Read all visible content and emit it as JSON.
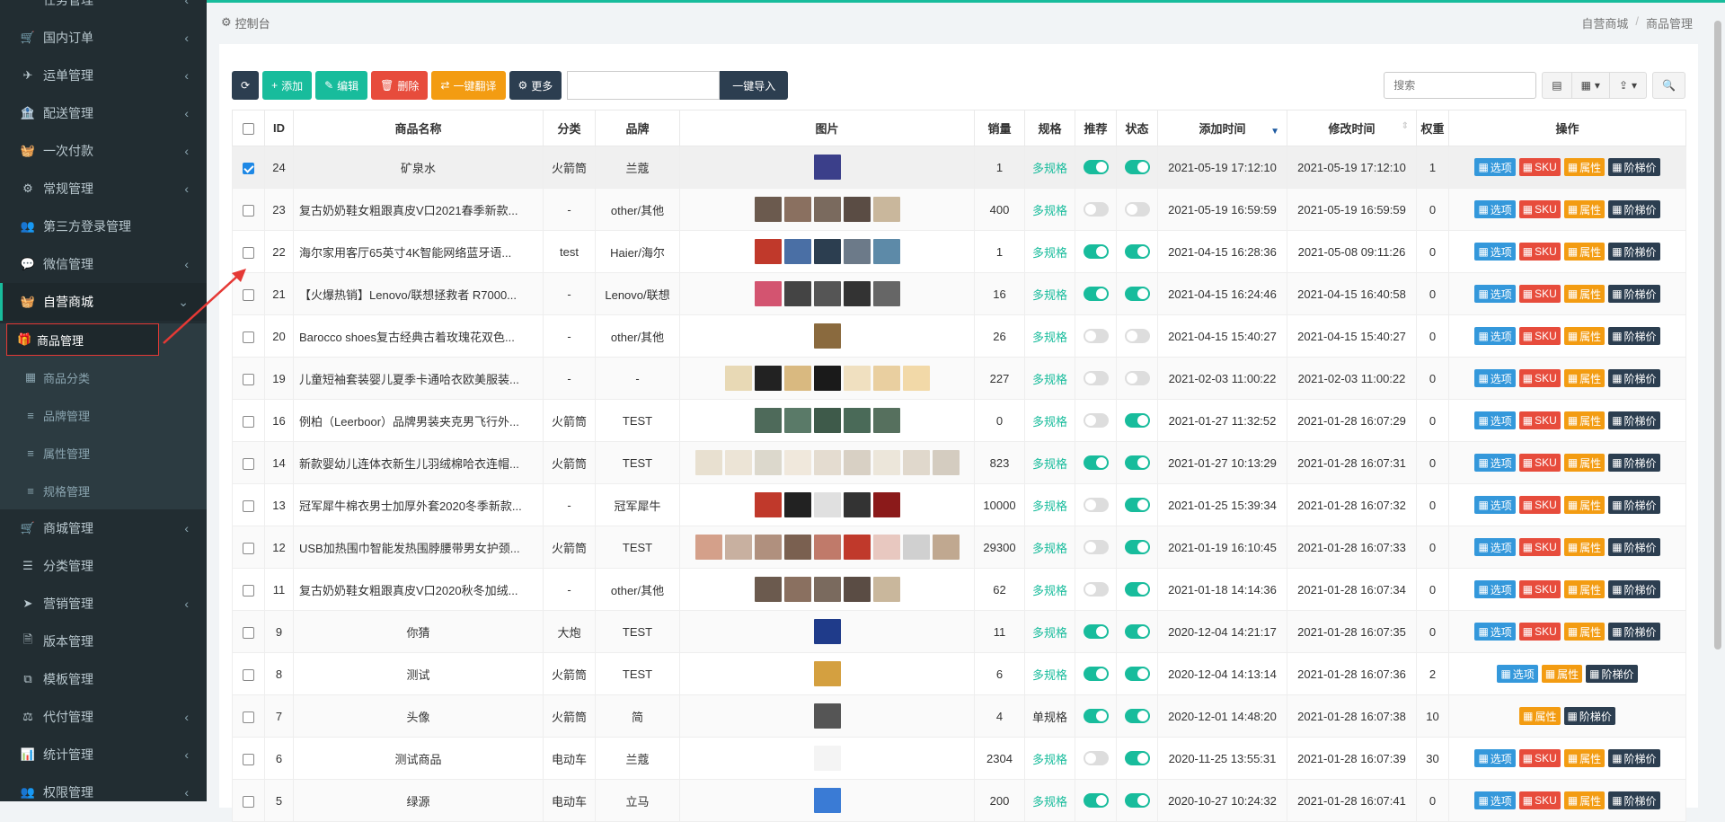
{
  "sidebar": {
    "items": [
      {
        "label": "任务管理",
        "icon": "",
        "chev": "‹"
      },
      {
        "label": "国内订单",
        "icon": "🛒",
        "chev": "‹"
      },
      {
        "label": "运单管理",
        "icon": "✈",
        "chev": "‹"
      },
      {
        "label": "配送管理",
        "icon": "🏦",
        "chev": "‹"
      },
      {
        "label": "一次付款",
        "icon": "🧺",
        "chev": "‹"
      },
      {
        "label": "常规管理",
        "icon": "⚙",
        "chev": "‹"
      },
      {
        "label": "第三方登录管理",
        "icon": "👥",
        "chev": ""
      },
      {
        "label": "微信管理",
        "icon": "💬",
        "chev": "‹"
      },
      {
        "label": "自营商城",
        "icon": "🧺",
        "chev": "⌄"
      }
    ],
    "subitems": [
      {
        "label": "商品管理",
        "icon": "🎁"
      },
      {
        "label": "商品分类",
        "icon": "▦"
      },
      {
        "label": "品牌管理",
        "icon": "≡"
      },
      {
        "label": "属性管理",
        "icon": "≡"
      },
      {
        "label": "规格管理",
        "icon": "≡"
      }
    ],
    "items2": [
      {
        "label": "商城管理",
        "icon": "🛒",
        "chev": "‹"
      },
      {
        "label": "分类管理",
        "icon": "☰",
        "chev": ""
      },
      {
        "label": "营销管理",
        "icon": "➤",
        "chev": "‹"
      },
      {
        "label": "版本管理",
        "icon": "🗎",
        "chev": ""
      },
      {
        "label": "模板管理",
        "icon": "⧉",
        "chev": ""
      },
      {
        "label": "代付管理",
        "icon": "⚖",
        "chev": "‹"
      },
      {
        "label": "统计管理",
        "icon": "📊",
        "chev": "‹"
      },
      {
        "label": "权限管理",
        "icon": "👥",
        "chev": "‹"
      }
    ]
  },
  "breadcrumb": {
    "left_icon": "⚙",
    "left": "控制台",
    "right": [
      "自营商城",
      "商品管理"
    ],
    "sep": "/"
  },
  "toolbar": {
    "refresh_icon": "⟳",
    "add": "添加",
    "add_icon": "+",
    "edit": "编辑",
    "edit_icon": "✎",
    "delete": "删除",
    "delete_icon": "🗑",
    "translate": "一键翻译",
    "translate_icon": "⇄",
    "more": "更多",
    "more_icon": "⚙",
    "import_input": "",
    "import": "一键导入",
    "search_placeholder": "搜索",
    "view_icon": "▤",
    "columns_icon": "▦",
    "export_icon": "⇪",
    "search_icon": "🔍"
  },
  "table": {
    "headers": [
      "ID",
      "商品名称",
      "分类",
      "品牌",
      "图片",
      "销量",
      "规格",
      "推荐",
      "状态",
      "添加时间",
      "修改时间",
      "权重",
      "操作"
    ],
    "sort_arrow": "▼",
    "op_labels": {
      "options": "选项",
      "sku": "SKU",
      "attr": "属性",
      "tier": "阶梯价"
    },
    "op_icons": {
      "options": "▦",
      "sku": "▦",
      "attr": "▦",
      "tier": "▦"
    },
    "rows": [
      {
        "id": "24",
        "name": "矿泉水",
        "center": true,
        "cat": "火箭筒",
        "brand": "兰蔻",
        "imgs": [
          "#3b3f8a"
        ],
        "sales": "1",
        "spec": "多规格",
        "rec": true,
        "status": true,
        "added": "2021-05-19 17:12:10",
        "modified": "2021-05-19 17:12:10",
        "weight": "1",
        "ops": [
          "options",
          "sku",
          "attr",
          "tier"
        ],
        "checked": true
      },
      {
        "id": "23",
        "name": "复古奶奶鞋女粗跟真皮V口2021春季新款...",
        "center": false,
        "cat": "-",
        "brand": "other/其他",
        "imgs": [
          "#6b5a4e",
          "#8a7060",
          "#7a6a5e",
          "#5a4c44",
          "#c9b79c"
        ],
        "sales": "400",
        "spec": "多规格",
        "rec": false,
        "status": false,
        "added": "2021-05-19 16:59:59",
        "modified": "2021-05-19 16:59:59",
        "weight": "0",
        "ops": [
          "options",
          "sku",
          "attr",
          "tier"
        ],
        "checked": false
      },
      {
        "id": "22",
        "name": "海尔家用客厅65英寸4K智能网络蓝牙语...",
        "center": false,
        "cat": "test",
        "brand": "Haier/海尔",
        "imgs": [
          "#c0392b",
          "#4a6fa5",
          "#2c3e50",
          "#6c7a89",
          "#5d8aa8"
        ],
        "sales": "1",
        "spec": "多规格",
        "rec": true,
        "status": true,
        "added": "2021-04-15 16:28:36",
        "modified": "2021-05-08 09:11:26",
        "weight": "0",
        "ops": [
          "options",
          "sku",
          "attr",
          "tier"
        ],
        "checked": false
      },
      {
        "id": "21",
        "name": "【火爆热销】Lenovo/联想拯救者 R7000...",
        "center": false,
        "cat": "-",
        "brand": "Lenovo/联想",
        "imgs": [
          "#d35470",
          "#444",
          "#555",
          "#333",
          "#666"
        ],
        "sales": "16",
        "spec": "多规格",
        "rec": true,
        "status": true,
        "added": "2021-04-15 16:24:46",
        "modified": "2021-04-15 16:40:58",
        "weight": "0",
        "ops": [
          "options",
          "sku",
          "attr",
          "tier"
        ],
        "checked": false
      },
      {
        "id": "20",
        "name": "Barocco shoes复古经典古着玫瑰花双色...",
        "center": false,
        "cat": "-",
        "brand": "other/其他",
        "imgs": [
          "#8a6a3e"
        ],
        "sales": "26",
        "spec": "多规格",
        "rec": false,
        "status": false,
        "added": "2021-04-15 15:40:27",
        "modified": "2021-04-15 15:40:27",
        "weight": "0",
        "ops": [
          "options",
          "sku",
          "attr",
          "tier"
        ],
        "checked": false
      },
      {
        "id": "19",
        "name": "儿童短袖套装婴儿夏季卡通哈衣欧美服装...",
        "center": false,
        "cat": "-",
        "brand": "-",
        "imgs": [
          "#e8d9b5",
          "#222",
          "#d9b980",
          "#1a1a1a",
          "#f0e0c0",
          "#e9cfa0",
          "#f2d9a8"
        ],
        "sales": "227",
        "spec": "多规格",
        "rec": false,
        "status": false,
        "added": "2021-02-03 11:00:22",
        "modified": "2021-02-03 11:00:22",
        "weight": "0",
        "ops": [
          "options",
          "sku",
          "attr",
          "tier"
        ],
        "checked": false
      },
      {
        "id": "16",
        "name": "例柏（Leerboor）品牌男装夹克男飞行外...",
        "center": false,
        "cat": "火箭筒",
        "brand": "TEST",
        "imgs": [
          "#4e6a5a",
          "#5a7a68",
          "#3e5a4a",
          "#4a6a58",
          "#56705e"
        ],
        "sales": "0",
        "spec": "多规格",
        "rec": false,
        "status": true,
        "added": "2021-01-27 11:32:52",
        "modified": "2021-01-28 16:07:29",
        "weight": "0",
        "ops": [
          "options",
          "sku",
          "attr",
          "tier"
        ],
        "checked": false
      },
      {
        "id": "14",
        "name": "新款婴幼儿连体衣新生儿羽绒棉哈衣连帽...",
        "center": false,
        "cat": "火箭筒",
        "brand": "TEST",
        "imgs": [
          "#e8e0d0",
          "#ece4d6",
          "#dcd8cc",
          "#f0e8dc",
          "#e4dcd0",
          "#d8d0c4",
          "#ece6da",
          "#e0d8cc",
          "#d4ccc0"
        ],
        "sales": "823",
        "spec": "多规格",
        "rec": true,
        "status": true,
        "added": "2021-01-27 10:13:29",
        "modified": "2021-01-28 16:07:31",
        "weight": "0",
        "ops": [
          "options",
          "sku",
          "attr",
          "tier"
        ],
        "checked": false
      },
      {
        "id": "13",
        "name": "冠军犀牛棉衣男士加厚外套2020冬季新款...",
        "center": false,
        "cat": "-",
        "brand": "冠军犀牛",
        "imgs": [
          "#c0392b",
          "#222",
          "#e0e0e0",
          "#333",
          "#8b1a1a"
        ],
        "sales": "10000",
        "spec": "多规格",
        "rec": false,
        "status": true,
        "added": "2021-01-25 15:39:34",
        "modified": "2021-01-28 16:07:32",
        "weight": "0",
        "ops": [
          "options",
          "sku",
          "attr",
          "tier"
        ],
        "checked": false
      },
      {
        "id": "12",
        "name": "USB加热围巾智能发热围脖腰带男女护颈...",
        "center": false,
        "cat": "火箭筒",
        "brand": "TEST",
        "imgs": [
          "#d4a08a",
          "#c8b0a0",
          "#b0907e",
          "#7a6050",
          "#c07a6a",
          "#c0392b",
          "#e8c8c0",
          "#d0d0d0",
          "#c0a890"
        ],
        "sales": "29300",
        "spec": "多规格",
        "rec": false,
        "status": true,
        "added": "2021-01-19 16:10:45",
        "modified": "2021-01-28 16:07:33",
        "weight": "0",
        "ops": [
          "options",
          "sku",
          "attr",
          "tier"
        ],
        "checked": false
      },
      {
        "id": "11",
        "name": "复古奶奶鞋女粗跟真皮V口2020秋冬加绒...",
        "center": false,
        "cat": "-",
        "brand": "other/其他",
        "imgs": [
          "#6b5a4e",
          "#8a7060",
          "#7a6a5e",
          "#5a4c44",
          "#c9b79c"
        ],
        "sales": "62",
        "spec": "多规格",
        "rec": false,
        "status": true,
        "added": "2021-01-18 14:14:36",
        "modified": "2021-01-28 16:07:34",
        "weight": "0",
        "ops": [
          "options",
          "sku",
          "attr",
          "tier"
        ],
        "checked": false
      },
      {
        "id": "9",
        "name": "你猜",
        "center": true,
        "cat": "大炮",
        "brand": "TEST",
        "imgs": [
          "#1f3b8a"
        ],
        "sales": "11",
        "spec": "多规格",
        "rec": true,
        "status": true,
        "added": "2020-12-04 14:21:17",
        "modified": "2021-01-28 16:07:35",
        "weight": "0",
        "ops": [
          "options",
          "sku",
          "attr",
          "tier"
        ],
        "checked": false
      },
      {
        "id": "8",
        "name": "测试",
        "center": true,
        "cat": "火箭筒",
        "brand": "TEST",
        "imgs": [
          "#d4a040"
        ],
        "sales": "6",
        "spec": "多规格",
        "rec": true,
        "status": true,
        "added": "2020-12-04 14:13:14",
        "modified": "2021-01-28 16:07:36",
        "weight": "2",
        "ops": [
          "options",
          "attr",
          "tier"
        ],
        "checked": false
      },
      {
        "id": "7",
        "name": "头像",
        "center": true,
        "cat": "火箭筒",
        "brand": "简",
        "imgs": [
          "#555"
        ],
        "sales": "4",
        "spec": "单规格",
        "rec": true,
        "status": true,
        "added": "2020-12-01 14:48:20",
        "modified": "2021-01-28 16:07:38",
        "weight": "10",
        "ops": [
          "attr",
          "tier"
        ],
        "checked": false
      },
      {
        "id": "6",
        "name": "测试商品",
        "center": true,
        "cat": "电动车",
        "brand": "兰蔻",
        "imgs": [
          "#f4f4f4"
        ],
        "sales": "2304",
        "spec": "多规格",
        "rec": false,
        "status": true,
        "added": "2020-11-25 13:55:31",
        "modified": "2021-01-28 16:07:39",
        "weight": "30",
        "ops": [
          "options",
          "sku",
          "attr",
          "tier"
        ],
        "checked": false
      },
      {
        "id": "5",
        "name": "绿源",
        "center": true,
        "cat": "电动车",
        "brand": "立马",
        "imgs": [
          "#3a7bd5"
        ],
        "sales": "200",
        "spec": "多规格",
        "rec": true,
        "status": true,
        "added": "2020-10-27 10:24:32",
        "modified": "2021-01-28 16:07:41",
        "weight": "0",
        "ops": [
          "options",
          "sku",
          "attr",
          "tier"
        ],
        "checked": false
      }
    ]
  },
  "colors": {
    "accent": "#18bc9c",
    "sidebar": "#222d32",
    "annotation": "#e53935"
  }
}
